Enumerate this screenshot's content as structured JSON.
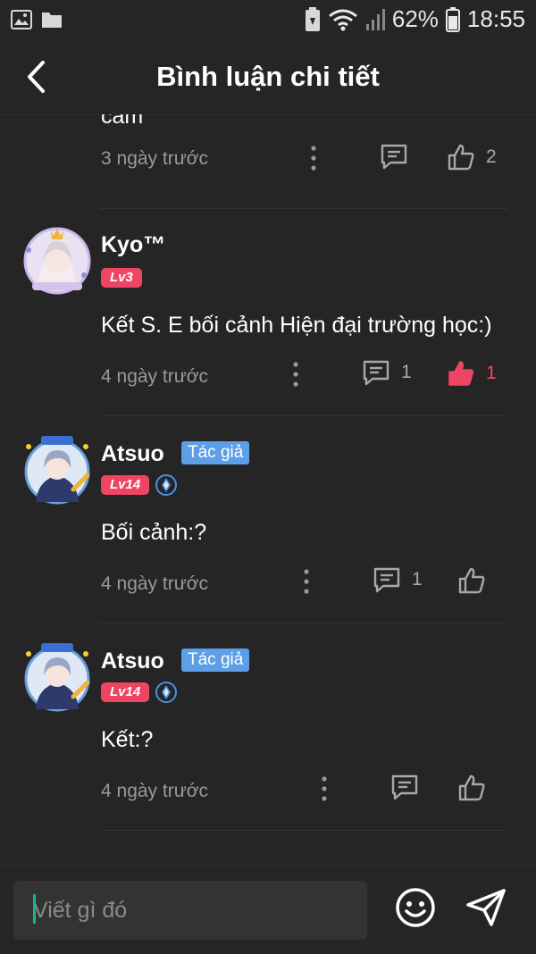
{
  "status_bar": {
    "battery_percent": "62%",
    "time": "18:55"
  },
  "header": {
    "title": "Bình luận chi tiết"
  },
  "comments": [
    {
      "text": "cam",
      "time": "3 ngày trước",
      "replies": "",
      "likes": "2",
      "liked": false
    },
    {
      "username": "Kyo™",
      "level": "Lv3",
      "text": "Kết S. E bối cảnh Hiện đại trường học:)",
      "time": "4 ngày trước",
      "replies": "1",
      "likes": "1",
      "liked": true
    },
    {
      "username": "Atsuo",
      "author_badge": "Tác giả",
      "level": "Lv14",
      "text": "Bối cảnh:?",
      "time": "4 ngày trước",
      "replies": "1",
      "likes": "",
      "liked": false
    },
    {
      "username": "Atsuo",
      "author_badge": "Tác giả",
      "level": "Lv14",
      "text": "Kết:?",
      "time": "4 ngày trước",
      "replies": "",
      "likes": "",
      "liked": false
    }
  ],
  "composer": {
    "placeholder": "Viết gì đó"
  },
  "colors": {
    "background": "#252525",
    "level_badge": "#ee4564",
    "author_badge": "#5d9fe6",
    "liked": "#ee4564",
    "caret": "#1ab394"
  }
}
